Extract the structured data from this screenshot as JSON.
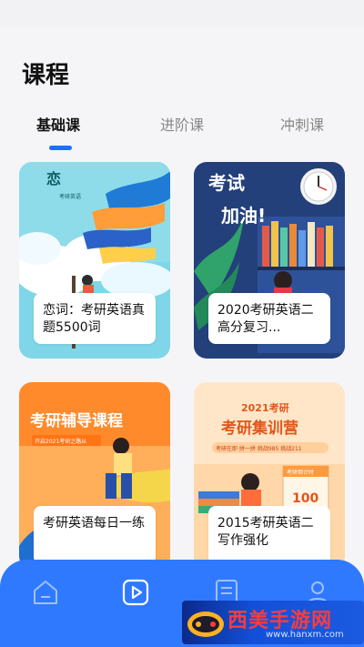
{
  "page": {
    "title": "课程"
  },
  "tabs": [
    {
      "label": "基础课",
      "active": true
    },
    {
      "label": "进阶课",
      "active": false
    },
    {
      "label": "冲刺课",
      "active": false
    }
  ],
  "courses": [
    {
      "title": "恋词：考研英语真题5500词",
      "cover_text": [
        "恋",
        "考研英语"
      ]
    },
    {
      "title": "2020考研英语二高分复习...",
      "cover_text": [
        "考试",
        "加油!"
      ]
    },
    {
      "title": "考研英语每日一练",
      "cover_text": [
        "考研辅导课程",
        "开启2021考研之路从"
      ]
    },
    {
      "title": "2015考研英语二写作强化",
      "cover_text": [
        "2021考研",
        "考研集训营",
        "考研在即 拼一拼 挑战985 挑战211",
        "考研倒计时",
        "100"
      ]
    }
  ],
  "bottom_nav": [
    {
      "icon": "home-icon"
    },
    {
      "icon": "play-icon"
    },
    {
      "icon": "document-icon"
    },
    {
      "icon": "user-icon"
    }
  ],
  "watermark": {
    "title": "西美手游网",
    "url": "www.hanxm.com"
  },
  "colors": {
    "accent": "#1e6fff",
    "nav_background": "#2f79ff",
    "background": "#f5f5f7"
  }
}
